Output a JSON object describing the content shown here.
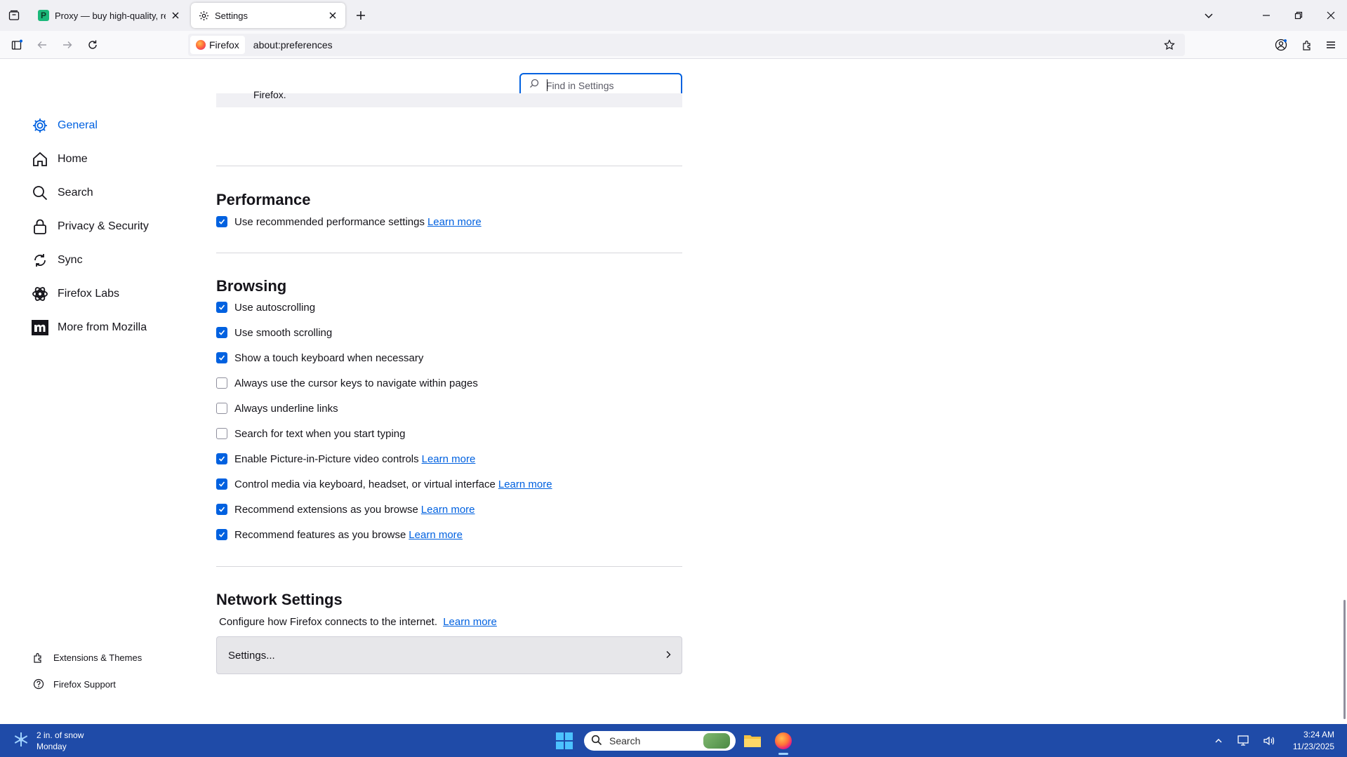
{
  "browser": {
    "tabs": [
      {
        "title": "Proxy — buy high-quality, reliab",
        "active": false,
        "favicon": "proxy-favicon"
      },
      {
        "title": "Settings",
        "active": true,
        "favicon": "gear-icon"
      }
    ],
    "identity_label": "Firefox",
    "url": "about:preferences"
  },
  "settings": {
    "search_placeholder": "Find in Settings",
    "categories": [
      {
        "label": "General",
        "icon": "gear-icon",
        "selected": true
      },
      {
        "label": "Home",
        "icon": "home-icon"
      },
      {
        "label": "Search",
        "icon": "search-icon"
      },
      {
        "label": "Privacy & Security",
        "icon": "lock-icon"
      },
      {
        "label": "Sync",
        "icon": "sync-icon"
      },
      {
        "label": "Firefox Labs",
        "icon": "labs-icon"
      },
      {
        "label": "More from Mozilla",
        "icon": "mozilla-icon"
      }
    ],
    "footer_links": [
      {
        "label": "Extensions & Themes",
        "icon": "puzzle-icon"
      },
      {
        "label": "Firefox Support",
        "icon": "help-icon"
      }
    ],
    "truncated_text": "Firefox.",
    "performance": {
      "heading": "Performance",
      "options": [
        {
          "label": "Use recommended performance settings",
          "checked": true,
          "learn_more": "Learn more"
        }
      ]
    },
    "browsing": {
      "heading": "Browsing",
      "options": [
        {
          "label": "Use autoscrolling",
          "checked": true
        },
        {
          "label": "Use smooth scrolling",
          "checked": true
        },
        {
          "label": "Show a touch keyboard when necessary",
          "checked": true
        },
        {
          "label": "Always use the cursor keys to navigate within pages",
          "checked": false
        },
        {
          "label": "Always underline links",
          "checked": false
        },
        {
          "label": "Search for text when you start typing",
          "checked": false
        },
        {
          "label": "Enable Picture-in-Picture video controls",
          "checked": true,
          "learn_more": "Learn more"
        },
        {
          "label": "Control media via keyboard, headset, or virtual interface",
          "checked": true,
          "learn_more": "Learn more"
        },
        {
          "label": "Recommend extensions as you browse",
          "checked": true,
          "learn_more": "Learn more"
        },
        {
          "label": "Recommend features as you browse",
          "checked": true,
          "learn_more": "Learn more"
        }
      ]
    },
    "network": {
      "heading": "Network Settings",
      "description": "Configure how Firefox connects to the internet.",
      "learn_more": "Learn more",
      "button_label": "Settings..."
    }
  },
  "taskbar": {
    "weather_line1": "2 in. of snow",
    "weather_line2": "Monday",
    "search_label": "Search",
    "time": "3:24 AM",
    "date": "11/23/2025"
  },
  "colors": {
    "accent": "#0061e0",
    "taskbar": "#1f4ba8",
    "tabstrip": "#f0f0f4"
  }
}
